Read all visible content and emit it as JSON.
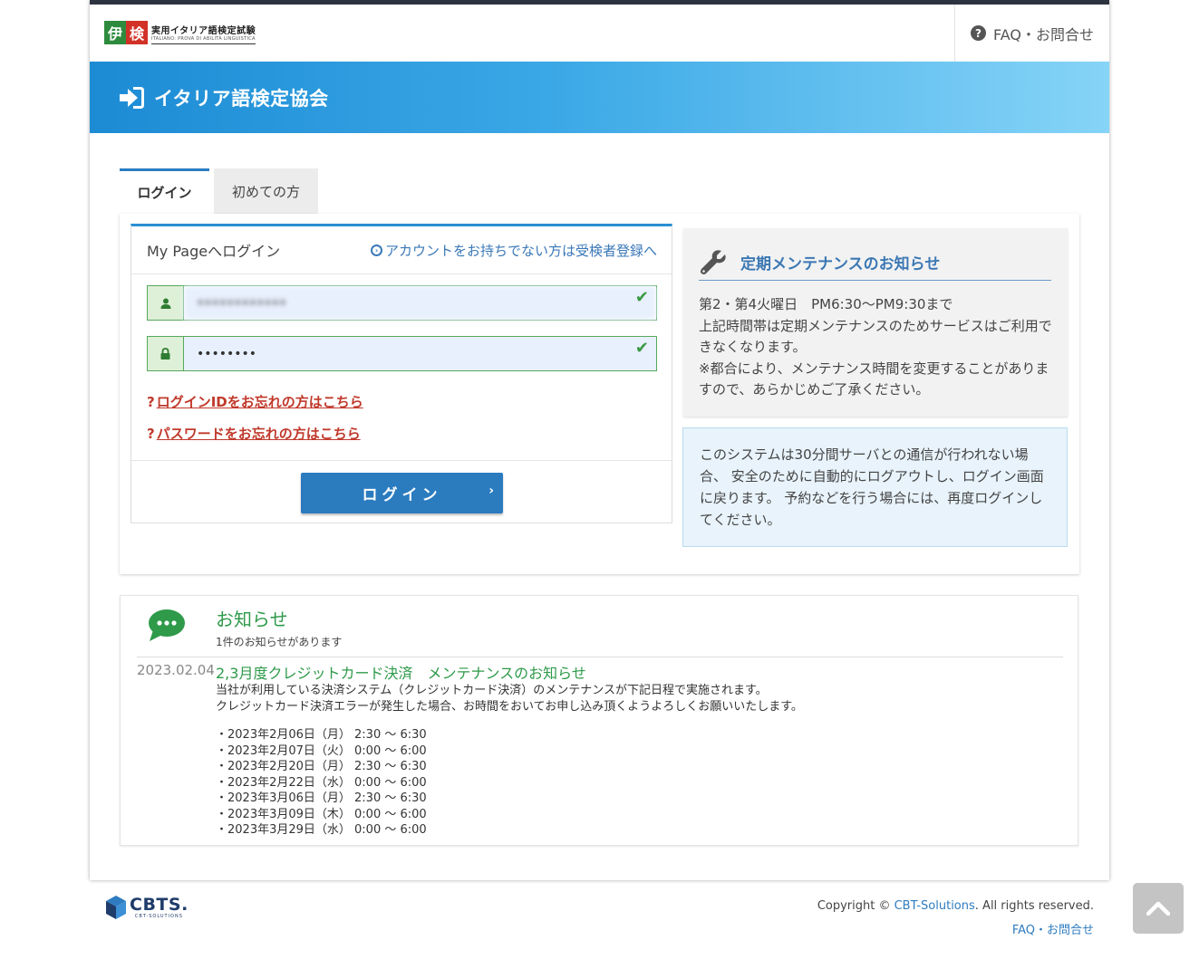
{
  "header": {
    "logo_kanji_1": "伊",
    "logo_kanji_2": "検",
    "logo_text": "実用イタリア語検定試験",
    "logo_subtext": "ITALIANO: PROVA DI ABILITÀ LINGUISTICA",
    "faq_label": "FAQ・お問合せ"
  },
  "banner": {
    "title": "イタリア語検定協会"
  },
  "tabs": [
    {
      "label": "ログイン",
      "active": true
    },
    {
      "label": "初めての方",
      "active": false
    }
  ],
  "login": {
    "panel_title": "My Pageへログイン",
    "register_link": "アカウントをお持ちでない方は受検者登録へ",
    "username_value": "••••••••••••",
    "password_value": "••••••••",
    "forgot_id": "ログインIDをお忘れの方はこちら",
    "forgot_pw": "パスワードをお忘れの方はこちら",
    "forgot_mark": "?",
    "button_label": "ログイン",
    "button_chevron": "›",
    "check_mark": "✔"
  },
  "maintenance": {
    "title": "定期メンテナンスのお知らせ",
    "line1": "第2・第4火曜日　PM6:30〜PM9:30まで",
    "line2": "上記時間帯は定期メンテナンスのためサービスはご利用できなくなります。",
    "line3": "※都合により、メンテナンス時間を変更することがありますので、あらかじめご了承ください。"
  },
  "session_notice": "このシステムは30分間サーバとの通信が行われない場合、 安全のために自動的にログアウトし、ログイン画面に戻ります。 予約などを行う場合には、再度ログインしてください。",
  "news": {
    "title": "お知らせ",
    "count_text": "1件のお知らせがあります",
    "items": [
      {
        "date": "2023.02.04",
        "headline": "2,3月度クレジットカード決済　メンテナンスのお知らせ",
        "body_line1": "当社が利用している決済システム（クレジットカード決済）のメンテナンスが下記日程で実施されます。",
        "body_line2": "クレジットカード決済エラーが発生した場合、お時間をおいてお申し込み頂くようよろしくお願いいたします。",
        "schedule": [
          "・2023年2月06日（月） 2:30 〜 6:30",
          "・2023年2月07日（火） 0:00 〜 6:00",
          "・2023年2月20日（月） 2:30 〜 6:30",
          "・2023年2月22日（水） 0:00 〜 6:00",
          "・2023年3月06日（月） 2:30 〜 6:30",
          "・2023年3月09日（木） 0:00 〜 6:00",
          "・2023年3月29日（水） 0:00 〜 6:00"
        ]
      }
    ]
  },
  "footer": {
    "logo_text": "CBTS.",
    "logo_sub": "CBT-SOLUTIONS",
    "copyright_prefix": "Copyright © ",
    "copyright_link": "CBT-Solutions",
    "copyright_suffix": ". All rights reserved.",
    "faq_label": "FAQ・お問合せ"
  },
  "colors": {
    "primary": "#2b7bbf",
    "accent_green": "#2e9a4a",
    "link_red": "#c0392b",
    "banner_start": "#1d8bd4",
    "banner_end": "#86d4f7"
  },
  "icons": {
    "faq": "question-circle-icon",
    "banner": "sign-in-icon",
    "user": "user-icon",
    "password": "lock-icon",
    "maintenance": "wrench-icon",
    "news": "chat-bubble-icon",
    "scroll_top": "chevron-up-icon"
  }
}
